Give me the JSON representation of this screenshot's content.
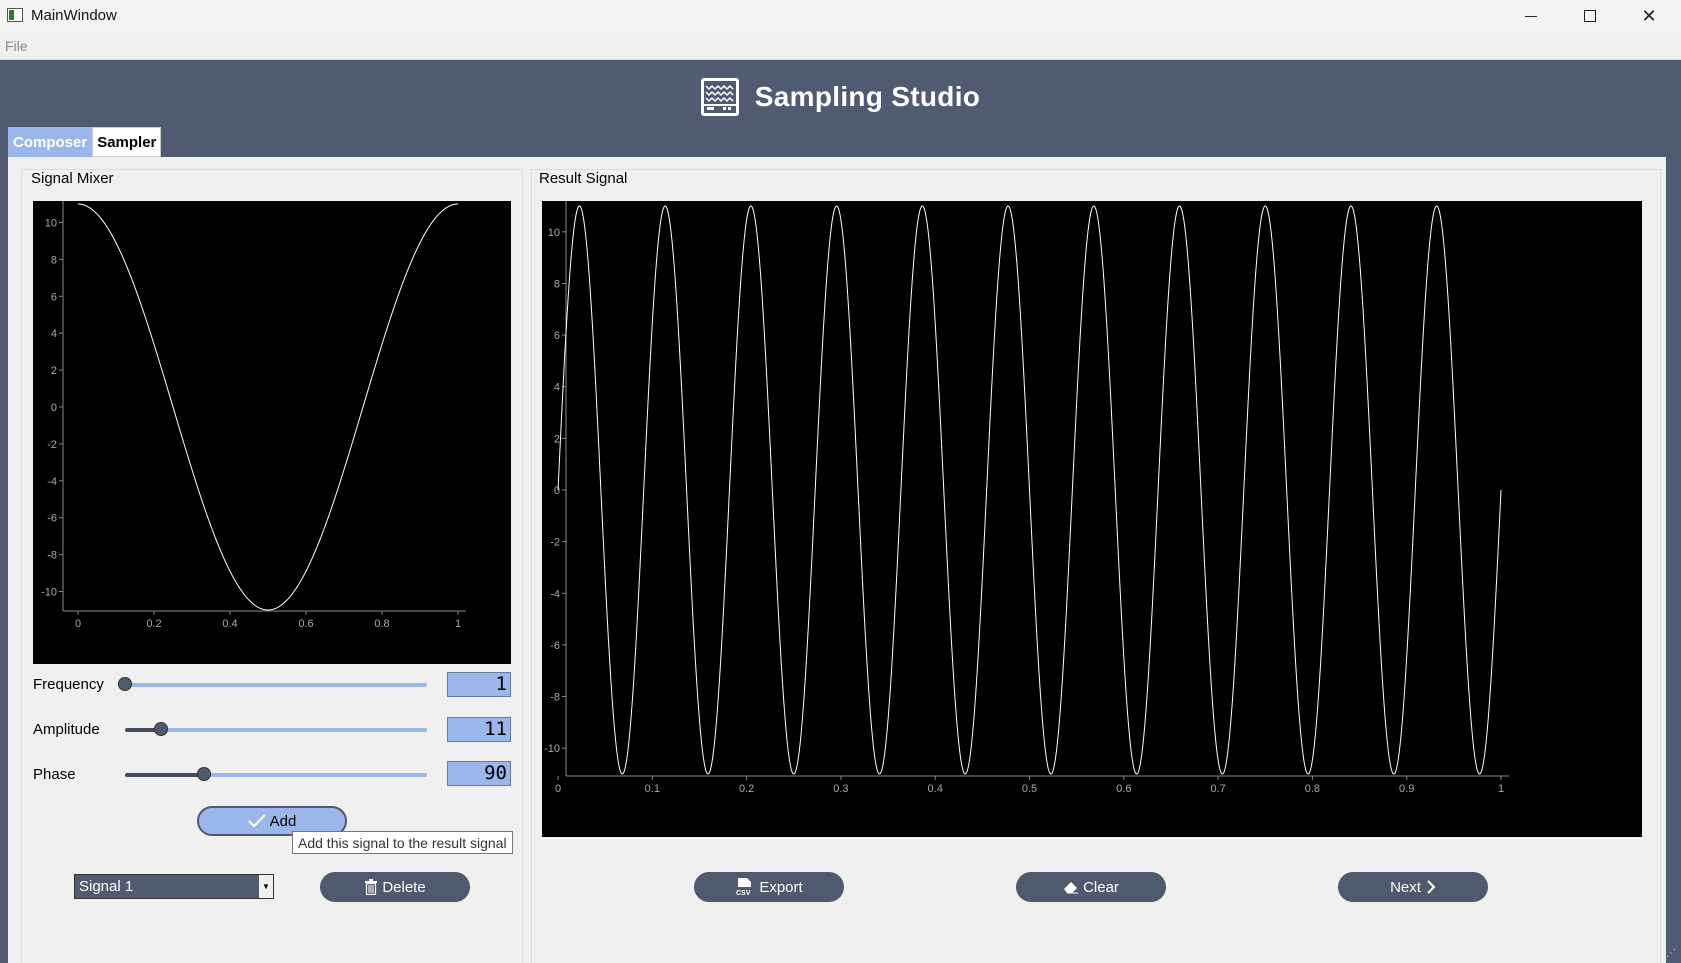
{
  "window": {
    "title": "MainWindow"
  },
  "menu": {
    "file": "File"
  },
  "app": {
    "title": "Sampling Studio"
  },
  "tabs": [
    {
      "label": "Composer",
      "active": true
    },
    {
      "label": "Sampler",
      "active": false
    }
  ],
  "mixer": {
    "title": "Signal Mixer",
    "frequency": {
      "label": "Frequency",
      "value": "1",
      "level": 0
    },
    "amplitude": {
      "label": "Amplitude",
      "value": "11",
      "level": 0.12
    },
    "phase": {
      "label": "Phase",
      "value": "90",
      "level": 0.26
    },
    "add_label": "Add",
    "add_tooltip": "Add this signal to the result signal",
    "signal_select": "Signal 1",
    "delete_label": "Delete"
  },
  "result": {
    "title": "Result Signal",
    "export_label": "Export",
    "clear_label": "Clear",
    "next_label": "Next",
    "export_badge": "CSV"
  },
  "colors": {
    "primary": "#505a70",
    "accent": "#9ab6ea",
    "plot_bg": "#000000"
  },
  "chart_data": [
    {
      "type": "line",
      "name": "signal-mixer-plot",
      "function": "11*sin(2*pi*1*t + 90deg)",
      "x_range": [
        0,
        1
      ],
      "ylim": [
        -11,
        11
      ],
      "x_ticks": [
        "0",
        "0.2",
        "0.4",
        "0.6",
        "0.8",
        "1"
      ],
      "y_ticks": [
        "10",
        "8",
        "6",
        "4",
        "2",
        "0",
        "-2",
        "-4",
        "-6",
        "-8",
        "-10"
      ],
      "frequency": 1,
      "amplitude": 11,
      "phase_deg": 90
    },
    {
      "type": "line",
      "name": "result-signal-plot",
      "function": "11*sin(2*pi*11*t)",
      "x_range": [
        0,
        1
      ],
      "ylim": [
        -11,
        11
      ],
      "x_ticks": [
        "0",
        "0.1",
        "0.2",
        "0.3",
        "0.4",
        "0.5",
        "0.6",
        "0.7",
        "0.8",
        "0.9",
        "1"
      ],
      "y_ticks": [
        "10",
        "8",
        "6",
        "4",
        "2",
        "0",
        "-2",
        "-4",
        "-6",
        "-8",
        "-10"
      ],
      "frequency": 11,
      "amplitude": 11,
      "phase_deg": 0
    }
  ]
}
